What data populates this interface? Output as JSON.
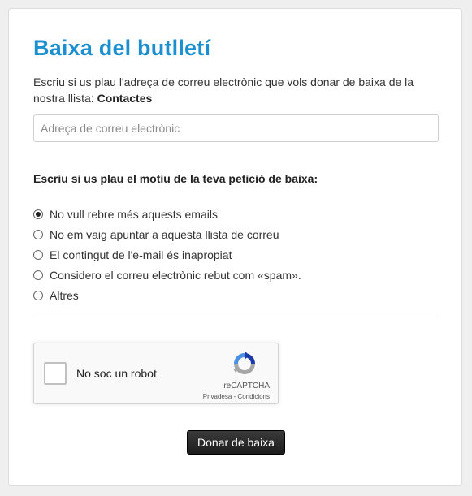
{
  "page": {
    "title": "Baixa del butlletí",
    "intro_text": "Escriu si us plau l'adreça de correu electrònic que vols donar de baixa de la nostra llista: ",
    "list_name": "Contactes"
  },
  "email_field": {
    "placeholder": "Adreça de correu electrònic",
    "value": ""
  },
  "reason": {
    "label": "Escriu si us plau el motiu de la teva petició de baixa:",
    "options": [
      {
        "label": "No vull rebre més aquests emails",
        "checked": true
      },
      {
        "label": "No em vaig apuntar a aquesta llista de correu",
        "checked": false
      },
      {
        "label": "El contingut de l'e-mail és inapropiat",
        "checked": false
      },
      {
        "label": "Considero el correu electrònic rebut com «spam».",
        "checked": false
      },
      {
        "label": "Altres",
        "checked": false
      }
    ]
  },
  "recaptcha": {
    "label": "No soc un robot",
    "brand": "reCAPTCHA",
    "privacy": "Privadesa",
    "separator": " - ",
    "terms": "Condicions",
    "checked": false
  },
  "submit": {
    "label": "Donar de baixa"
  },
  "colors": {
    "title": "#1b8fcf",
    "button": "#222222",
    "background": "#efefef",
    "card": "#ffffff"
  },
  "icons": {
    "recaptcha_logo": "recaptcha-logo-icon"
  }
}
